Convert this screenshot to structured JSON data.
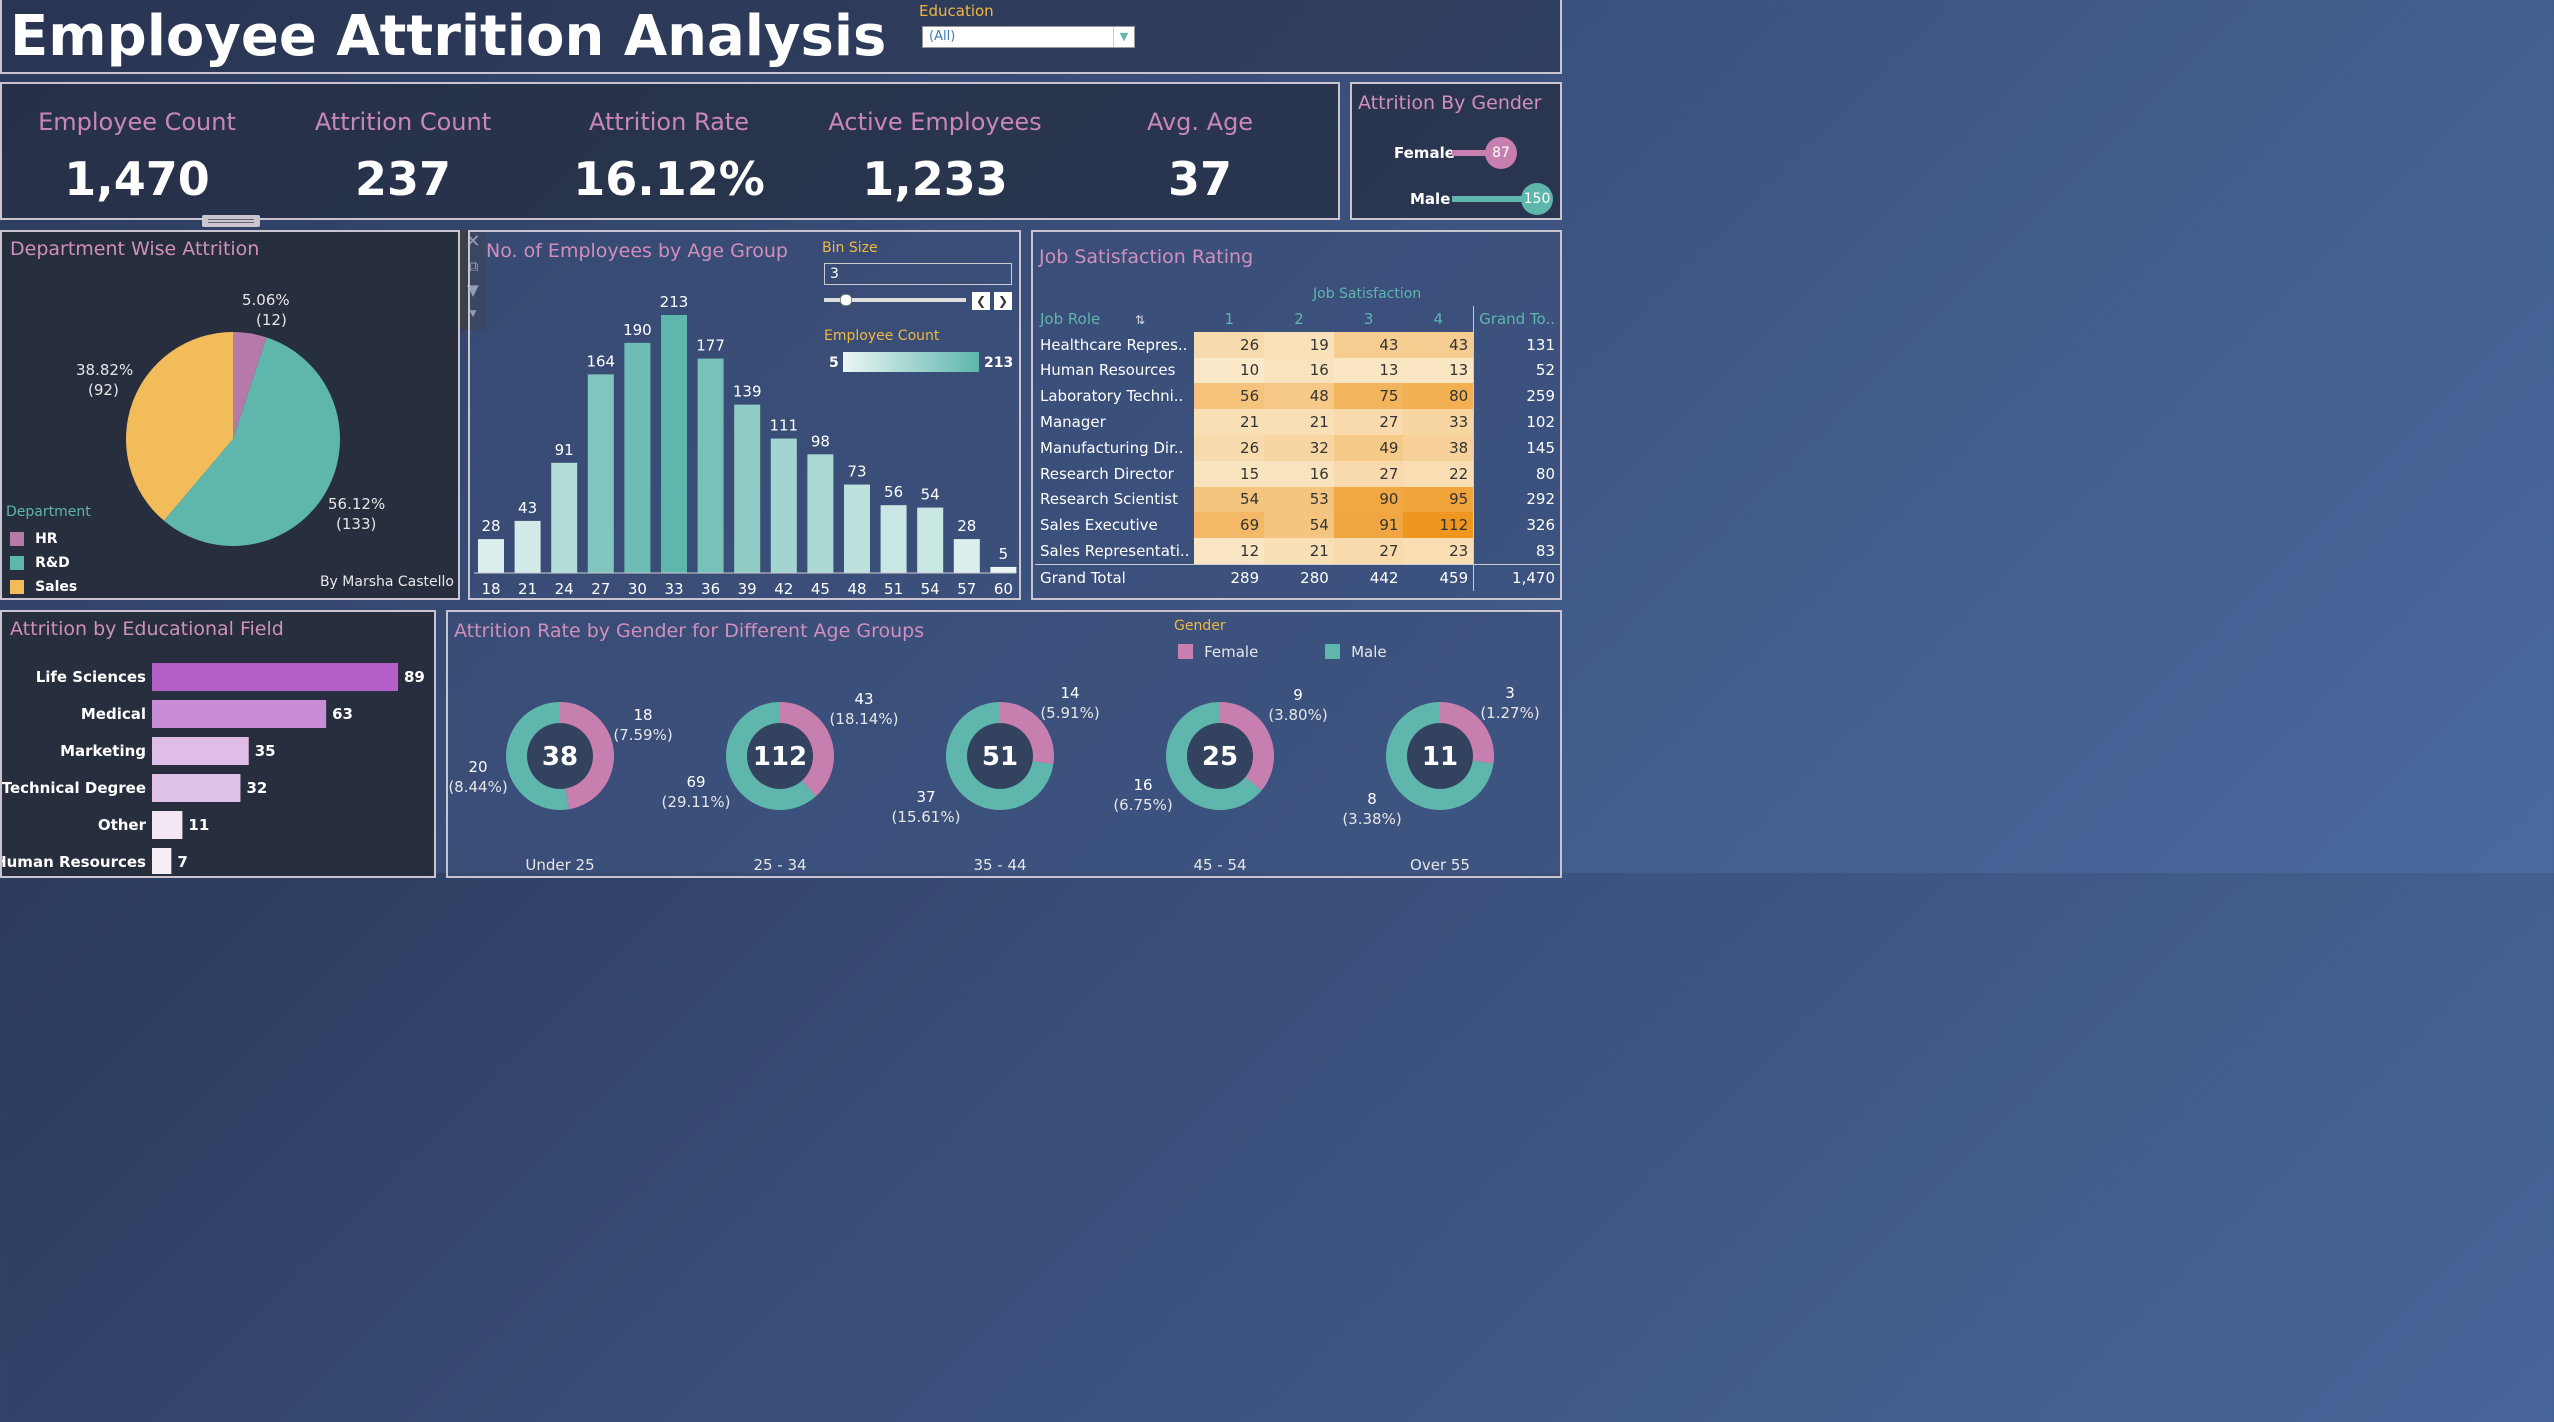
{
  "header": {
    "title": "Employee Attrition Analysis",
    "filter_label": "Education",
    "filter_value": "(All)"
  },
  "kpis": [
    {
      "label": "Employee Count",
      "value": "1,470"
    },
    {
      "label": "Attrition Count",
      "value": "237"
    },
    {
      "label": "Attrition Rate",
      "value": "16.12%"
    },
    {
      "label": "Active Employees",
      "value": "1,233"
    },
    {
      "label": "Avg. Age",
      "value": "37"
    }
  ],
  "gender_attrition": {
    "title": "Attrition By Gender",
    "rows": [
      {
        "label": "Female",
        "value": "87",
        "color": "#c77fb0"
      },
      {
        "label": "Male",
        "value": "150",
        "color": "#5fb6ad"
      }
    ]
  },
  "department": {
    "title": "Department Wise Attrition",
    "legend_title": "Department",
    "legend": [
      {
        "label": "HR",
        "color": "#b67aa8"
      },
      {
        "label": "R&D",
        "color": "#5fb6ad"
      },
      {
        "label": "Sales",
        "color": "#f3bc5b"
      }
    ],
    "slice_labels": [
      {
        "pct": "5.06%",
        "count": "(12)"
      },
      {
        "pct": "56.12%",
        "count": "(133)"
      },
      {
        "pct": "38.82%",
        "count": "(92)"
      }
    ],
    "author": "By Marsha Castello"
  },
  "age_group": {
    "title": "No. of Employees by Age Group",
    "bin_label": "Bin Size",
    "bin_value": "3",
    "legend_title": "Employee Count",
    "legend_min": "5",
    "legend_max": "213"
  },
  "job_satisfaction": {
    "title": "Job Satisfaction Rating",
    "subheader": "Job Satisfaction",
    "col_role": "Job Role",
    "cols": [
      "1",
      "2",
      "3",
      "4"
    ],
    "col_total": "Grand To..",
    "rows": [
      {
        "role": "Healthcare Repres..",
        "vals": [
          "26",
          "19",
          "43",
          "43"
        ],
        "total": "131"
      },
      {
        "role": "Human Resources",
        "vals": [
          "10",
          "16",
          "13",
          "13"
        ],
        "total": "52"
      },
      {
        "role": "Laboratory Techni..",
        "vals": [
          "56",
          "48",
          "75",
          "80"
        ],
        "total": "259"
      },
      {
        "role": "Manager",
        "vals": [
          "21",
          "21",
          "27",
          "33"
        ],
        "total": "102"
      },
      {
        "role": "Manufacturing Dir..",
        "vals": [
          "26",
          "32",
          "49",
          "38"
        ],
        "total": "145"
      },
      {
        "role": "Research Director",
        "vals": [
          "15",
          "16",
          "27",
          "22"
        ],
        "total": "80"
      },
      {
        "role": "Research Scientist",
        "vals": [
          "54",
          "53",
          "90",
          "95"
        ],
        "total": "292"
      },
      {
        "role": "Sales Executive",
        "vals": [
          "69",
          "54",
          "91",
          "112"
        ],
        "total": "326"
      },
      {
        "role": "Sales Representati..",
        "vals": [
          "12",
          "21",
          "27",
          "23"
        ],
        "total": "83"
      }
    ],
    "grand": {
      "role": "Grand Total",
      "vals": [
        "289",
        "280",
        "442",
        "459"
      ],
      "total": "1,470"
    }
  },
  "edu_field": {
    "title": "Attrition by Educational Field"
  },
  "age_gender": {
    "title": "Attrition Rate by Gender for Different Age Groups",
    "legend_title": "Gender",
    "legend": [
      {
        "label": "Female",
        "color": "#c77fb0"
      },
      {
        "label": "Male",
        "color": "#5fb6ad"
      }
    ],
    "groups": [
      {
        "name": "Under 25",
        "total": "38",
        "female": "18",
        "female_pct": "(7.59%)",
        "male": "20",
        "male_pct": "(8.44%)"
      },
      {
        "name": "25 - 34",
        "total": "112",
        "female": "43",
        "female_pct": "(18.14%)",
        "male": "69",
        "male_pct": "(29.11%)"
      },
      {
        "name": "35 - 44",
        "total": "51",
        "female": "14",
        "female_pct": "(5.91%)",
        "male": "37",
        "male_pct": "(15.61%)"
      },
      {
        "name": "45 - 54",
        "total": "25",
        "female": "9",
        "female_pct": "(3.80%)",
        "male": "16",
        "male_pct": "(6.75%)"
      },
      {
        "name": "Over 55",
        "total": "11",
        "female": "3",
        "female_pct": "(1.27%)",
        "male": "8",
        "male_pct": "(3.38%)"
      }
    ]
  },
  "chart_data": [
    {
      "type": "pie",
      "labels": [
        "HR",
        "R&D",
        "Sales"
      ],
      "values": [
        12,
        133,
        92
      ],
      "percents": [
        5.06,
        56.12,
        38.82
      ]
    },
    {
      "type": "bar",
      "categories": [
        "18",
        "21",
        "24",
        "27",
        "30",
        "33",
        "36",
        "39",
        "42",
        "45",
        "48",
        "51",
        "54",
        "57",
        "60"
      ],
      "values": [
        28,
        43,
        91,
        164,
        190,
        213,
        177,
        139,
        111,
        98,
        73,
        56,
        54,
        28,
        5
      ]
    },
    {
      "type": "bar",
      "orientation": "horizontal",
      "categories": [
        "Life Sciences",
        "Medical",
        "Marketing",
        "Technical Degree",
        "Other",
        "Human Resources"
      ],
      "values": [
        89,
        63,
        35,
        32,
        11,
        7
      ]
    }
  ]
}
